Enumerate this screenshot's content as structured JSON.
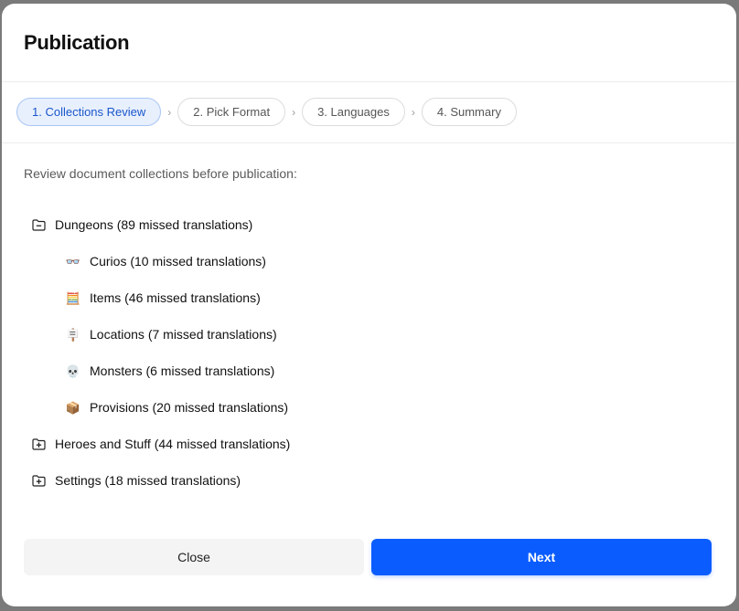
{
  "dialog": {
    "title": "Publication"
  },
  "steps": [
    {
      "label": "1. Collections Review",
      "active": true
    },
    {
      "label": "2. Pick Format",
      "active": false
    },
    {
      "label": "3. Languages",
      "active": false
    },
    {
      "label": "4. Summary",
      "active": false
    }
  ],
  "intro": "Review document collections before publication:",
  "tree": {
    "dungeons": {
      "label": "Dungeons (89 missed translations)",
      "icon": "folder-minus-icon",
      "children": [
        {
          "label": "Curios (10 missed translations)",
          "icon": "glasses-icon",
          "glyph": "👓"
        },
        {
          "label": "Items (46 missed translations)",
          "icon": "abacus-icon",
          "glyph": "🧮"
        },
        {
          "label": "Locations (7 missed translations)",
          "icon": "signpost-icon",
          "glyph": "🪧"
        },
        {
          "label": "Monsters (6 missed translations)",
          "icon": "skull-icon",
          "glyph": "💀"
        },
        {
          "label": "Provisions (20 missed translations)",
          "icon": "package-icon",
          "glyph": "📦"
        }
      ]
    },
    "heroes": {
      "label": "Heroes and Stuff (44 missed translations)",
      "icon": "folder-plus-icon"
    },
    "settings": {
      "label": "Settings (18 missed translations)",
      "icon": "folder-plus-icon"
    }
  },
  "footer": {
    "close_label": "Close",
    "next_label": "Next"
  },
  "colors": {
    "accent": "#0a5cff",
    "active_step_bg": "#e8f0fe",
    "active_step_text": "#1a56c9"
  }
}
